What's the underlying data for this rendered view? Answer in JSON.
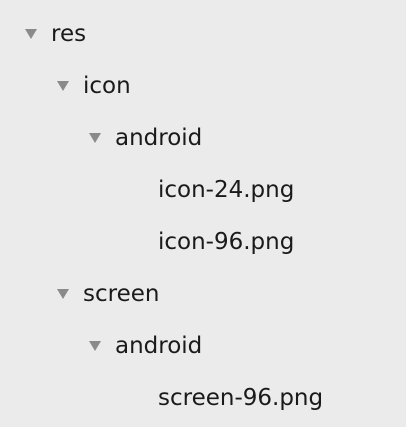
{
  "tree": {
    "root": {
      "label": "res",
      "expanded": true,
      "icon": "disclosure-triangle-down-icon"
    },
    "icon_folder": {
      "label": "icon",
      "expanded": true,
      "icon": "disclosure-triangle-down-icon"
    },
    "icon_android": {
      "label": "android",
      "expanded": true,
      "icon": "disclosure-triangle-down-icon"
    },
    "icon_files": [
      "icon-24.png",
      "icon-96.png"
    ],
    "screen_folder": {
      "label": "screen",
      "expanded": true,
      "icon": "disclosure-triangle-down-icon"
    },
    "screen_android": {
      "label": "android",
      "expanded": true,
      "icon": "disclosure-triangle-down-icon"
    },
    "screen_files": [
      "screen-96.png"
    ]
  },
  "colors": {
    "background": "#ebebeb",
    "text": "#1a1a1a",
    "triangle": "#8a8a8a"
  }
}
